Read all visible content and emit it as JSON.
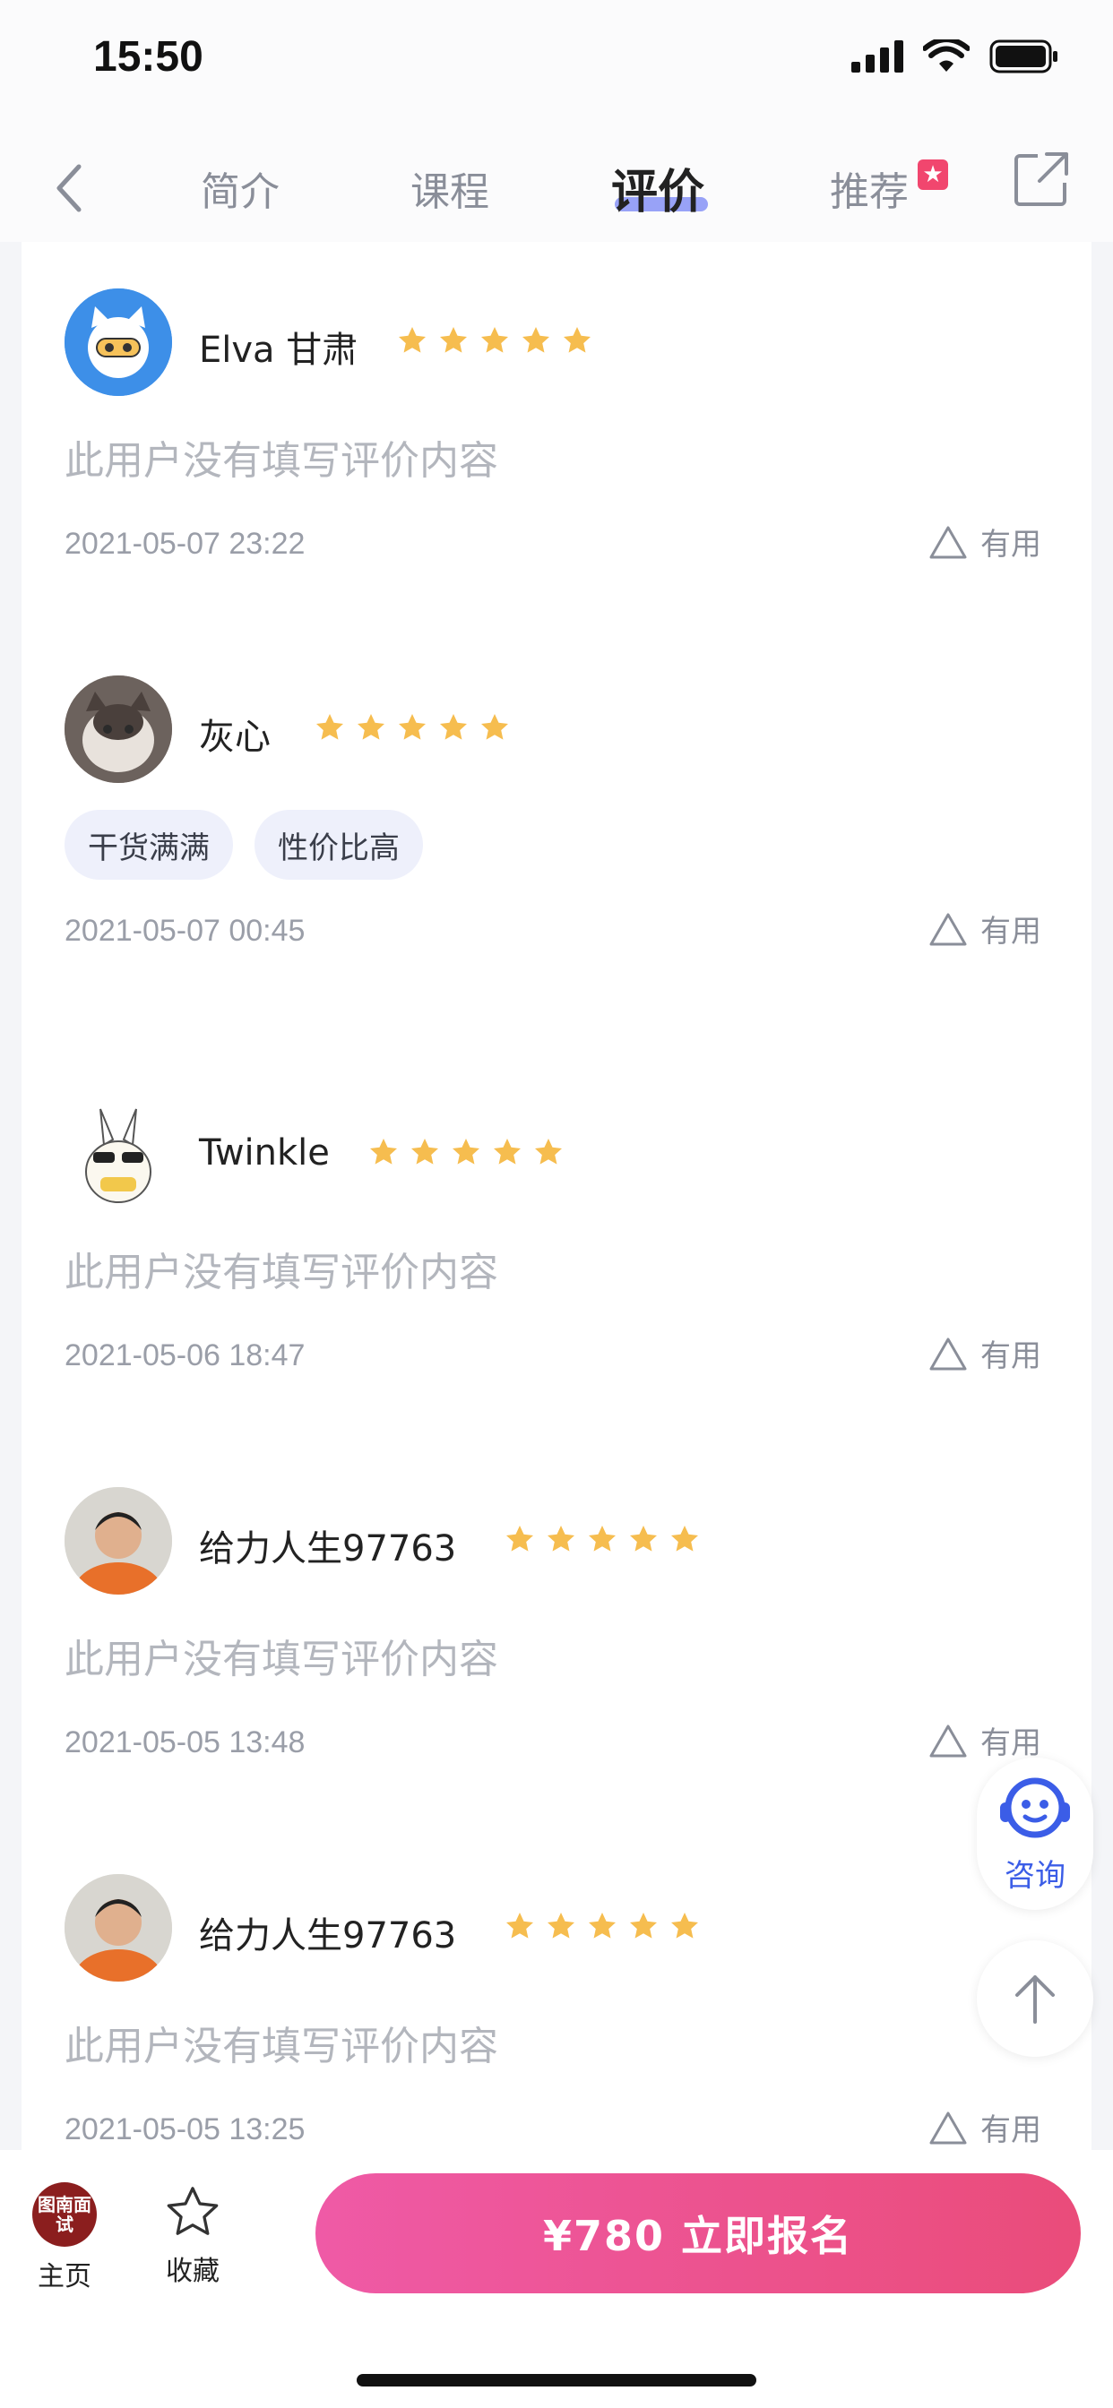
{
  "status_bar": {
    "time": "15:50"
  },
  "nav": {
    "back_icon": "chevron-left-icon",
    "tabs": [
      {
        "label": "简介"
      },
      {
        "label": "课程"
      },
      {
        "label": "评价"
      },
      {
        "label": "推荐"
      }
    ],
    "active_tab": "评价",
    "share_icon": "share-icon"
  },
  "reviews": [
    {
      "name": "Elva 甘肃",
      "rating": 5,
      "text": "此用户没有填写评价内容",
      "date": "2021-05-07 23:22",
      "useful": "有用",
      "tags": []
    },
    {
      "name": "灰心",
      "rating": 5,
      "text": "",
      "date": "2021-05-07 00:45",
      "useful": "有用",
      "tags": [
        "干货满满",
        "性价比高"
      ]
    },
    {
      "name": "Twinkle",
      "rating": 5,
      "text": "此用户没有填写评价内容",
      "date": "2021-05-06 18:47",
      "useful": "有用",
      "tags": []
    },
    {
      "name": "给力人生97763",
      "rating": 5,
      "text": "此用户没有填写评价内容",
      "date": "2021-05-05 13:48",
      "useful": "有用",
      "tags": []
    },
    {
      "name": "给力人生97763",
      "rating": 5,
      "text": "此用户没有填写评价内容",
      "date": "2021-05-05 13:25",
      "useful": "有用",
      "tags": []
    }
  ],
  "float": {
    "consult_label": "咨询"
  },
  "bottom_bar": {
    "logo_text": "图南面试",
    "home_label": "主页",
    "favorite_label": "收藏",
    "buy_label": "¥780 立即报名"
  },
  "colors": {
    "accent": "#7f8cf5",
    "star": "#f6bd4f",
    "buy_gradient_start": "#ef5aa6",
    "buy_gradient_end": "#ea4c7a",
    "consult_blue": "#3b5de7"
  }
}
